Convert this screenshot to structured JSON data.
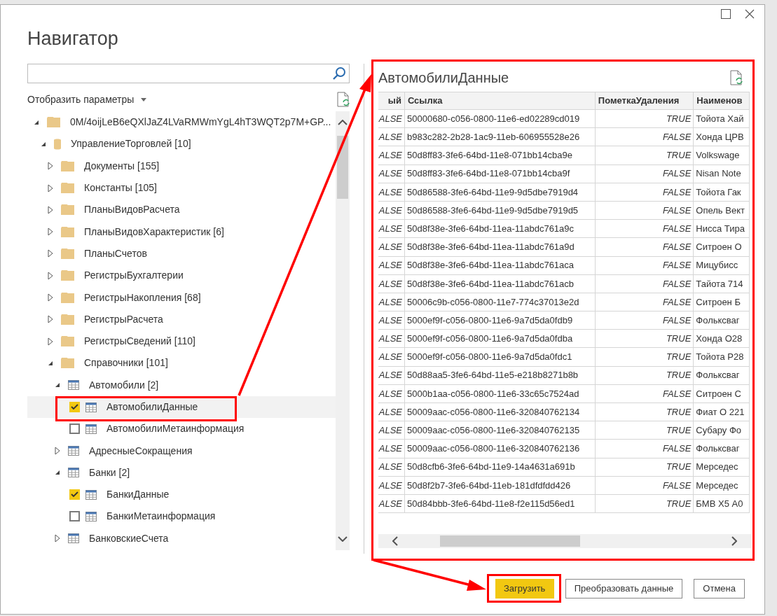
{
  "window": {
    "title": "Навигатор"
  },
  "display_options": {
    "label": "Отобразить параметры"
  },
  "tree": [
    {
      "label": "0M/4oijLeB6eQXlJaZ4LVaRMWmYgL4hT3WQT2p7M+GP...",
      "kind": "folder",
      "expanded": true,
      "selected": false,
      "children": [
        {
          "label": "УправлениеТорговлей [10]",
          "kind": "database",
          "expanded": true,
          "selected": false,
          "children": [
            {
              "label": "Документы [155]",
              "kind": "folder",
              "expanded": false,
              "selected": false
            },
            {
              "label": "Константы [105]",
              "kind": "folder",
              "expanded": false,
              "selected": false
            },
            {
              "label": "ПланыВидовРасчета",
              "kind": "folder",
              "expanded": false,
              "selected": false
            },
            {
              "label": "ПланыВидовХарактеристик [6]",
              "kind": "folder",
              "expanded": false,
              "selected": false
            },
            {
              "label": "ПланыСчетов",
              "kind": "folder",
              "expanded": false,
              "selected": false
            },
            {
              "label": "РегистрыБухгалтерии",
              "kind": "folder",
              "expanded": false,
              "selected": false
            },
            {
              "label": "РегистрыНакопления [68]",
              "kind": "folder",
              "expanded": false,
              "selected": false
            },
            {
              "label": "РегистрыРасчета",
              "kind": "folder",
              "expanded": false,
              "selected": false
            },
            {
              "label": "РегистрыСведений [110]",
              "kind": "folder",
              "expanded": false,
              "selected": false
            },
            {
              "label": "Справочники [101]",
              "kind": "folder",
              "expanded": true,
              "selected": false,
              "children": [
                {
                  "label": "Автомобили [2]",
                  "kind": "table",
                  "expanded": true,
                  "selected": false,
                  "children": [
                    {
                      "label": "АвтомобилиДанные",
                      "kind": "leaf",
                      "checked": true,
                      "selected": true
                    },
                    {
                      "label": "АвтомобилиМетаинформация",
                      "kind": "leaf",
                      "checked": false,
                      "selected": false
                    }
                  ]
                },
                {
                  "label": "АдресныеСокращения",
                  "kind": "table",
                  "expanded": false,
                  "selected": false
                },
                {
                  "label": "Банки [2]",
                  "kind": "table",
                  "expanded": true,
                  "selected": false,
                  "children": [
                    {
                      "label": "БанкиДанные",
                      "kind": "leaf",
                      "checked": true,
                      "selected": false
                    },
                    {
                      "label": "БанкиМетаинформация",
                      "kind": "leaf",
                      "checked": false,
                      "selected": false
                    }
                  ]
                },
                {
                  "label": "БанковскиеСчета",
                  "kind": "table",
                  "expanded": false,
                  "selected": false
                }
              ]
            }
          ]
        }
      ]
    }
  ],
  "preview": {
    "title": "АвтомобилиДанные",
    "columns": [
      "ый",
      "Ссылка",
      "ПометкаУдаления",
      "Наименов"
    ],
    "rows": [
      [
        "ALSE",
        "50000680-c056-0800-11e6-ed02289cd019",
        "TRUE",
        "Тойота Хай"
      ],
      [
        "ALSE",
        "b983c282-2b28-1ac9-11eb-606955528e26",
        "FALSE",
        "Хонда ЦРВ"
      ],
      [
        "ALSE",
        "50d8ff83-3fe6-64bd-11e8-071bb14cba9e",
        "TRUE",
        "Volkswage"
      ],
      [
        "ALSE",
        "50d8ff83-3fe6-64bd-11e8-071bb14cba9f",
        "FALSE",
        "Nisan Note"
      ],
      [
        "ALSE",
        "50d86588-3fe6-64bd-11e9-9d5dbe7919d4",
        "FALSE",
        "Тойота Гак"
      ],
      [
        "ALSE",
        "50d86588-3fe6-64bd-11e9-9d5dbe7919d5",
        "FALSE",
        "Опель Вект"
      ],
      [
        "ALSE",
        "50d8f38e-3fe6-64bd-11ea-11abdc761a9c",
        "FALSE",
        "Нисса Тира"
      ],
      [
        "ALSE",
        "50d8f38e-3fe6-64bd-11ea-11abdc761a9d",
        "FALSE",
        "Ситроен О"
      ],
      [
        "ALSE",
        "50d8f38e-3fe6-64bd-11ea-11abdc761aca",
        "FALSE",
        "Мицубисс"
      ],
      [
        "ALSE",
        "50d8f38e-3fe6-64bd-11ea-11abdc761acb",
        "FALSE",
        "Тайота 714"
      ],
      [
        "ALSE",
        "50006c9b-c056-0800-11e7-774c37013e2d",
        "FALSE",
        "Ситроен Б"
      ],
      [
        "ALSE",
        "5000ef9f-c056-0800-11e6-9a7d5da0fdb9",
        "FALSE",
        "Фольксваг"
      ],
      [
        "ALSE",
        "5000ef9f-c056-0800-11e6-9a7d5da0fdba",
        "TRUE",
        "Хонда О28"
      ],
      [
        "ALSE",
        "5000ef9f-c056-0800-11e6-9a7d5da0fdc1",
        "TRUE",
        "Тойота Р28"
      ],
      [
        "ALSE",
        "50d88aa5-3fe6-64bd-11e5-e218b8271b8b",
        "TRUE",
        "Фольксваг"
      ],
      [
        "ALSE",
        "5000b1aa-c056-0800-11e6-33c65c7524ad",
        "FALSE",
        "Ситроен С"
      ],
      [
        "ALSE",
        "50009aac-c056-0800-11e6-320840762134",
        "TRUE",
        "Фиат О 221"
      ],
      [
        "ALSE",
        "50009aac-c056-0800-11e6-320840762135",
        "TRUE",
        "Субару Фо"
      ],
      [
        "ALSE",
        "50009aac-c056-0800-11e6-320840762136",
        "FALSE",
        "Фольксваг"
      ],
      [
        "ALSE",
        "50d8cfb6-3fe6-64bd-11e9-14a4631a691b",
        "TRUE",
        "Мерседес"
      ],
      [
        "ALSE",
        "50d8f2b7-3fe6-64bd-11eb-181dfdfdd426",
        "FALSE",
        "Мерседес"
      ],
      [
        "ALSE",
        "50d84bbb-3fe6-64bd-11e8-f2e115d56ed1",
        "TRUE",
        "БМВ X5 А0"
      ]
    ]
  },
  "buttons": [
    {
      "label": "Загрузить",
      "kind": "primary"
    },
    {
      "label": "Преобразовать данные",
      "kind": "secondary"
    },
    {
      "label": "Отмена",
      "kind": "secondary"
    }
  ]
}
